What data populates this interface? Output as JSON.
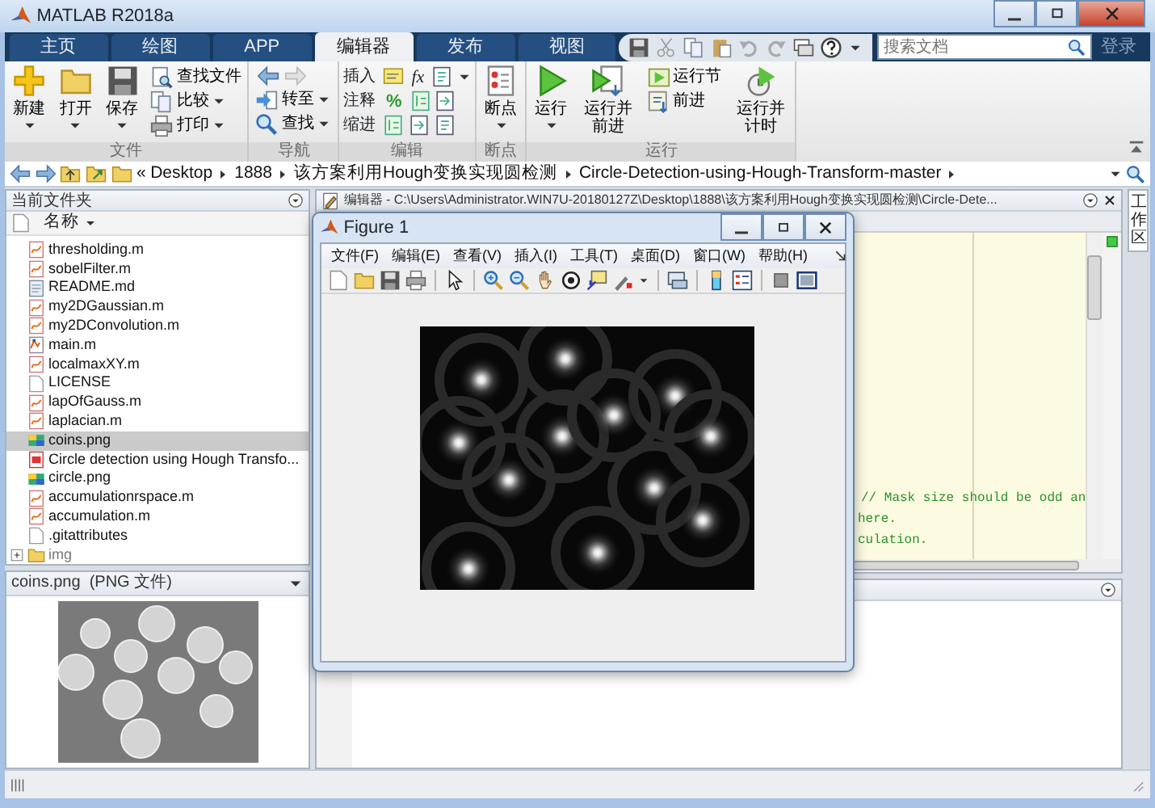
{
  "window": {
    "title": "MATLAB R2018a"
  },
  "tabs": [
    {
      "label": "主页",
      "selected": false
    },
    {
      "label": "绘图",
      "selected": false
    },
    {
      "label": "APP",
      "selected": false
    },
    {
      "label": "编辑器",
      "selected": true
    },
    {
      "label": "发布",
      "selected": false
    },
    {
      "label": "视图",
      "selected": false
    }
  ],
  "search": {
    "placeholder": "搜索文档"
  },
  "sign_in": "登录",
  "ribbon": {
    "groups": [
      {
        "label": "文件",
        "items": [
          {
            "kind": "large",
            "label": "新建",
            "dropdown": true
          },
          {
            "kind": "large",
            "label": "打开",
            "dropdown": true
          },
          {
            "kind": "large",
            "label": "保存",
            "dropdown": true
          },
          {
            "kind": "stack",
            "rows": [
              {
                "kind": "button",
                "label": "查找文件",
                "dropdown": false
              },
              {
                "kind": "button",
                "label": "比较",
                "dropdown": true
              },
              {
                "kind": "button",
                "label": "打印",
                "dropdown": true
              }
            ]
          }
        ]
      },
      {
        "label": "导航",
        "items": [
          {
            "kind": "stack",
            "rows": [
              {
                "kind": "history",
                "buttons": [
                  {
                    "disabled": false
                  },
                  {
                    "disabled": true
                  }
                ]
              },
              {
                "kind": "button",
                "label": "转至",
                "dropdown": true
              },
              {
                "kind": "button",
                "label": "查找",
                "dropdown": true
              }
            ]
          }
        ]
      },
      {
        "label": "编辑",
        "items": [
          {
            "kind": "stack",
            "rows": [
              {
                "kind": "tools",
                "label": "插入",
                "glyph": "fx",
                "dropdown": true
              },
              {
                "kind": "tools",
                "label": "注释",
                "glyph": "%",
                "dropdown": false
              },
              {
                "kind": "tools",
                "label": "缩进",
                "dropdown": false
              }
            ]
          }
        ]
      },
      {
        "label": "断点",
        "items": [
          {
            "kind": "large",
            "label": "断点",
            "dropdown": true
          }
        ]
      },
      {
        "label": "运行",
        "items": [
          {
            "kind": "large",
            "label": "运行",
            "dropdown": true
          },
          {
            "kind": "large",
            "label": "运行并前进",
            "dropdown": false
          },
          {
            "kind": "stack",
            "rows": [
              {
                "kind": "button",
                "label": "运行节",
                "dropdown": false
              },
              {
                "kind": "button",
                "label": "前进",
                "dropdown": false
              }
            ]
          },
          {
            "kind": "large",
            "label": "运行并计时",
            "dropdown": false
          }
        ]
      }
    ]
  },
  "address": {
    "overflow_mark": "«",
    "crumbs": [
      "Desktop",
      "1888",
      "该方案利用Hough变换实现圆检测",
      "Circle-Detection-using-Hough-Transform-master"
    ]
  },
  "current_folder": {
    "title": "当前文件夹",
    "column": "名称",
    "files": [
      {
        "name": "thresholding.m",
        "kind": "function",
        "selected": false
      },
      {
        "name": "sobelFilter.m",
        "kind": "function",
        "selected": false
      },
      {
        "name": "README.md",
        "kind": "text",
        "selected": false
      },
      {
        "name": "my2DGaussian.m",
        "kind": "function",
        "selected": false
      },
      {
        "name": "my2DConvolution.m",
        "kind": "function",
        "selected": false
      },
      {
        "name": "main.m",
        "kind": "script",
        "selected": false
      },
      {
        "name": "localmaxXY.m",
        "kind": "function",
        "selected": false
      },
      {
        "name": "LICENSE",
        "kind": "blank",
        "selected": false
      },
      {
        "name": "lapOfGauss.m",
        "kind": "function",
        "selected": false
      },
      {
        "name": "laplacian.m",
        "kind": "function",
        "selected": false
      },
      {
        "name": "coins.png",
        "kind": "image",
        "selected": true
      },
      {
        "name": "Circle detection using Hough Transfo...",
        "kind": "pdf",
        "selected": false
      },
      {
        "name": "circle.png",
        "kind": "image",
        "selected": false
      },
      {
        "name": "accumulationrspace.m",
        "kind": "function",
        "selected": false
      },
      {
        "name": "accumulation.m",
        "kind": "function",
        "selected": false
      },
      {
        "name": ".gitattributes",
        "kind": "blank",
        "selected": false
      },
      {
        "name": "img",
        "kind": "folder",
        "selected": false,
        "expanded": false
      }
    ]
  },
  "details": {
    "name": "coins.png",
    "type": "(PNG 文件)"
  },
  "editor": {
    "title": "编辑器 - C:\\Users\\Administrator.WIN7U-20180127Z\\Desktop\\1888\\该方案利用Hough变换实现圆检测\\Circle-Dete...",
    "code_lines": [
      "// Mask size should be odd an",
      "here.",
      "culation."
    ]
  },
  "workspace_tab": "工作区",
  "figure": {
    "title": "Figure 1",
    "menus": [
      "文件(F)",
      "编辑(E)",
      "查看(V)",
      "插入(I)",
      "工具(T)",
      "桌面(D)",
      "窗口(W)",
      "帮助(H)"
    ]
  }
}
